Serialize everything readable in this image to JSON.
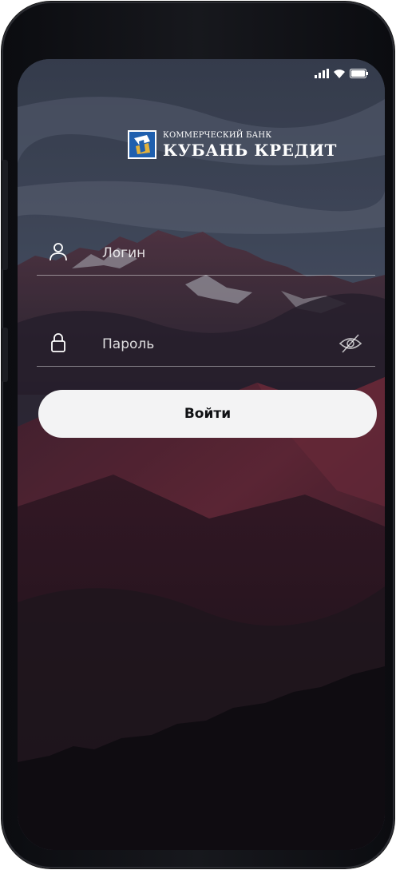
{
  "brand": {
    "small_text": "КОММЕРЧЕСКИЙ БАНК",
    "name": "КУБАНЬ КРЕДИТ"
  },
  "status_bar": {
    "icons": [
      "signal-icon",
      "wifi-icon",
      "battery-icon"
    ]
  },
  "form": {
    "login_placeholder": "Логин",
    "password_placeholder": "Пароль",
    "login_icon": "user-icon",
    "password_icon": "lock-icon",
    "toggle_visibility_icon": "eye-slash-icon",
    "submit_label": "Войти"
  },
  "colors": {
    "button_bg": "#f3f3f4",
    "button_text": "#101114",
    "logo_blue": "#1f5fae",
    "logo_gold": "#e2b13c"
  }
}
